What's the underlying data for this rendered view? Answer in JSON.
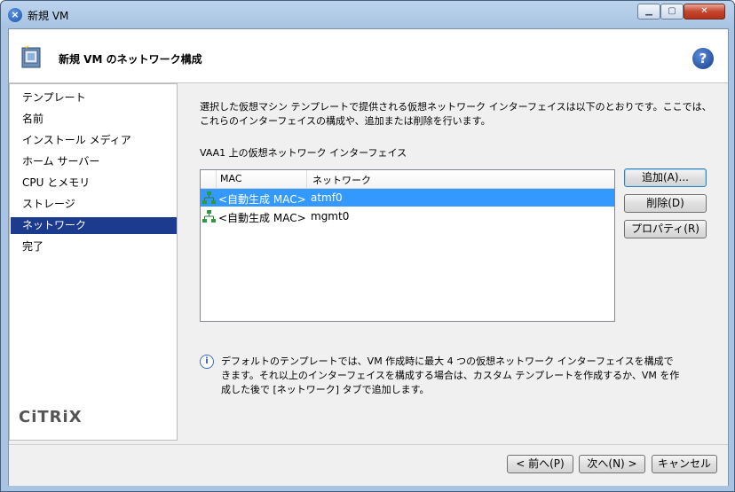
{
  "window": {
    "title": "新規 VM",
    "app_icon": "close-circle-icon",
    "controls": {
      "minimize": "minimize-icon",
      "maximize": "maximize-icon",
      "close": "close-icon"
    }
  },
  "header": {
    "title": "新規 VM のネットワーク構成",
    "help_glyph": "?"
  },
  "sidebar": {
    "items": [
      {
        "label": "テンプレート",
        "active": false
      },
      {
        "label": "名前",
        "active": false
      },
      {
        "label": "インストール メディア",
        "active": false
      },
      {
        "label": "ホーム サーバー",
        "active": false
      },
      {
        "label": "CPU とメモリ",
        "active": false
      },
      {
        "label": "ストレージ",
        "active": false
      },
      {
        "label": "ネットワーク",
        "active": true
      },
      {
        "label": "完了",
        "active": false
      }
    ],
    "logo": "CiTRiX"
  },
  "main": {
    "description": "選択した仮想マシン テンプレートで提供される仮想ネットワーク インターフェイスは以下のとおりです。ここでは、これらのインターフェイスの構成や、追加または削除を行います。",
    "list_label": "VAA1 上の仮想ネットワーク インターフェイス",
    "columns": [
      "MAC",
      "ネットワーク"
    ],
    "rows": [
      {
        "mac": "<自動生成 MAC>",
        "network": "atmf0",
        "selected": true
      },
      {
        "mac": "<自動生成 MAC>",
        "network": "mgmt0",
        "selected": false
      }
    ],
    "buttons": {
      "add": "追加(A)...",
      "delete": "削除(D)",
      "properties": "プロパティ(R)"
    },
    "info_glyph": "i",
    "info_text": "デフォルトのテンプレートでは、VM 作成時に最大 4 つの仮想ネットワーク インターフェイスを構成できます。それ以上のインターフェイスを構成する場合は、カスタム テンプレートを作成するか、VM を作成した後で [ネットワーク] タブで追加します。"
  },
  "footer": {
    "back": "< 前へ(P)",
    "next": "次へ(N) >",
    "cancel": "キャンセル"
  },
  "colors": {
    "selection": "#3399ff",
    "sidebar_active": "#1c3a8e",
    "titlebar": "#a9c4e3"
  }
}
